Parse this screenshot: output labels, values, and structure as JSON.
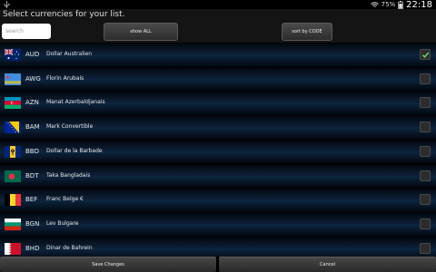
{
  "status": {
    "battery": "75%",
    "time": "22:18"
  },
  "header": {
    "prompt": "Select currencies for your list.",
    "search_placeholder": "search",
    "show_all_label": "show ALL",
    "sort_label": "sort by CODE"
  },
  "currencies": [
    {
      "code": "AUD",
      "name": "Dollar Australien",
      "checked": true,
      "flag": "australia-flag-icon"
    },
    {
      "code": "AWG",
      "name": "Florin Arubais",
      "checked": false,
      "flag": "aruba-flag-icon"
    },
    {
      "code": "AZN",
      "name": "Manat Azerbaldjanais",
      "checked": false,
      "flag": "azerbaijan-flag-icon"
    },
    {
      "code": "BAM",
      "name": "Mark Convertible",
      "checked": false,
      "flag": "bosnia-flag-icon"
    },
    {
      "code": "BBD",
      "name": "Dollar de la Barbade",
      "checked": false,
      "flag": "barbados-flag-icon"
    },
    {
      "code": "BDT",
      "name": "Taka Bangladais",
      "checked": false,
      "flag": "bangladesh-flag-icon"
    },
    {
      "code": "BEF",
      "name": "Franc Belge €",
      "checked": false,
      "flag": "belgium-flag-icon"
    },
    {
      "code": "BGN",
      "name": "Lev Bulgare",
      "checked": false,
      "flag": "bulgaria-flag-icon"
    },
    {
      "code": "BHD",
      "name": "Dinar de Bahrein",
      "checked": false,
      "flag": "bahrain-flag-icon"
    }
  ],
  "footer": {
    "save_label": "Save Changes",
    "cancel_label": "Cancel"
  },
  "colors": {
    "row_glow": "#0d2540",
    "check_green": "#5fd35f",
    "background": "#000000"
  }
}
